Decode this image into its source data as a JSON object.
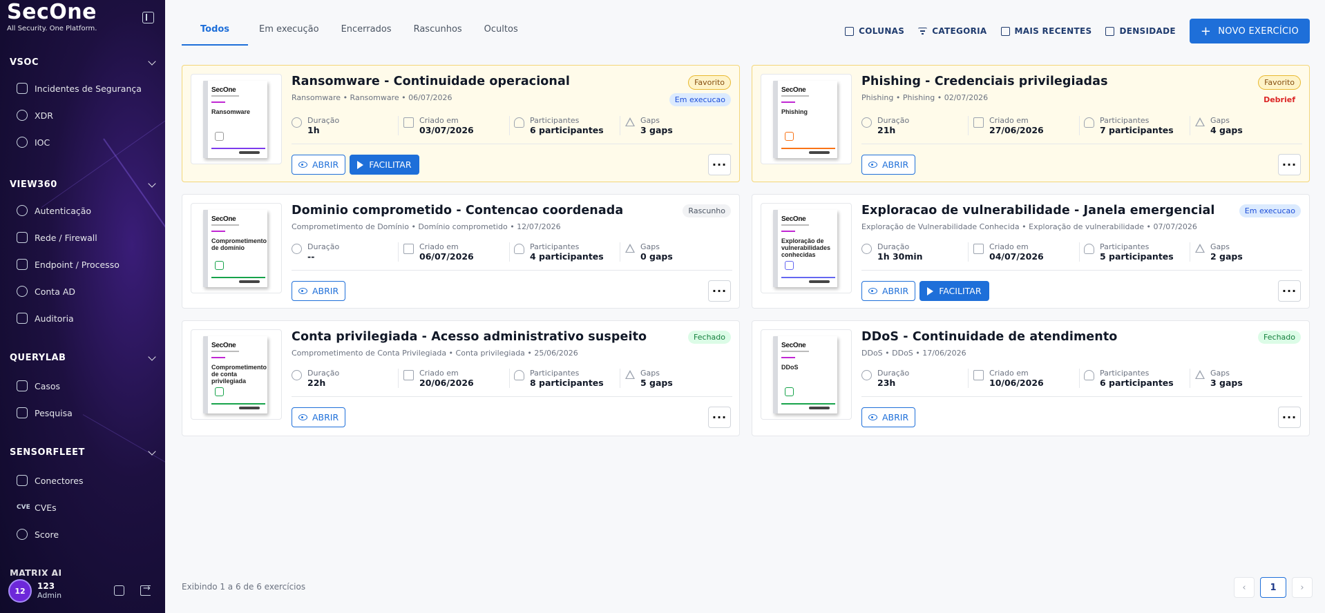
{
  "brand": {
    "name": "SecOne",
    "tagline": "All Security. One Platform."
  },
  "sidebar": {
    "sections": [
      {
        "title": "VSOC",
        "items": [
          {
            "label": "Incidentes de Segurança",
            "icon": "incident-icon"
          },
          {
            "label": "XDR",
            "icon": "radar-icon"
          },
          {
            "label": "IOC",
            "icon": "target-icon"
          }
        ]
      },
      {
        "title": "VIEW360",
        "items": [
          {
            "label": "Autenticação",
            "icon": "key-icon"
          },
          {
            "label": "Rede / Firewall",
            "icon": "network-icon"
          },
          {
            "label": "Endpoint / Processo",
            "icon": "cpu-icon"
          },
          {
            "label": "Conta AD",
            "icon": "user-icon"
          },
          {
            "label": "Auditoria",
            "icon": "audit-icon"
          }
        ]
      },
      {
        "title": "QUERYLAB",
        "items": [
          {
            "label": "Casos",
            "icon": "briefcase-icon"
          },
          {
            "label": "Pesquisa",
            "icon": "search-doc-icon"
          }
        ]
      },
      {
        "title": "SENSORFLEET",
        "items": [
          {
            "label": "Conectores",
            "icon": "connector-icon"
          },
          {
            "label": "CVEs",
            "icon": "cve-icon"
          },
          {
            "label": "Score",
            "icon": "gauge-icon"
          }
        ]
      }
    ],
    "partial_section": "MATRIX AI",
    "user": {
      "initials": "12",
      "name": "123",
      "role": "Admin"
    }
  },
  "tabs": [
    "Todos",
    "Em execução",
    "Encerrados",
    "Rascunhos",
    "Ocultos"
  ],
  "active_tab": "Todos",
  "toolbar": {
    "columns": "COLUNAS",
    "category": "CATEGORIA",
    "sort": "MAIS RECENTES",
    "density": "DENSIDADE",
    "new_button": "NOVO EXERCÍCIO"
  },
  "labels": {
    "duration": "Duração",
    "created": "Criado em",
    "participants": "Participantes",
    "gaps": "Gaps",
    "open": "ABRIR",
    "facilitate": "FACILITAR",
    "more": "···"
  },
  "cards": [
    {
      "title": "Ransomware - Continuidade operacional",
      "subtitle": "Ransomware • Ransomware • 06/07/2026",
      "cover_title": "Ransomware",
      "badges": [
        "Favorito",
        "Em execucao"
      ],
      "duration": "1h",
      "created": "03/07/2026",
      "participants": "6 participantes",
      "gaps": "3 gaps"
    },
    {
      "title": "Phishing - Credenciais privilegiadas",
      "subtitle": "Phishing • Phishing • 02/07/2026",
      "cover_title": "Phishing",
      "badges": [
        "Favorito",
        "Debrief"
      ],
      "duration": "21h",
      "created": "27/06/2026",
      "participants": "7 participantes",
      "gaps": "4 gaps"
    },
    {
      "title": "Dominio comprometido - Contencao coordenada",
      "subtitle": "Comprometimento de Domínio • Domínio comprometido • 12/07/2026",
      "cover_title": "Comprometimento de domínio",
      "badges": [
        "Rascunho"
      ],
      "duration": "--",
      "created": "06/07/2026",
      "participants": "4 participantes",
      "gaps": "0 gaps"
    },
    {
      "title": "Exploracao de vulnerabilidade - Janela emergencial",
      "subtitle": "Exploração de Vulnerabilidade Conhecida • Exploração de vulnerabilidade • 07/07/2026",
      "cover_title": "Exploração de vulnerabilidades conhecidas",
      "badges": [
        "Em execucao"
      ],
      "duration": "1h 30min",
      "created": "04/07/2026",
      "participants": "5 participantes",
      "gaps": "2 gaps"
    },
    {
      "title": "Conta privilegiada - Acesso administrativo suspeito",
      "subtitle": "Comprometimento de Conta Privilegiada • Conta privilegiada • 25/06/2026",
      "cover_title": "Comprometimento de conta privilegiada",
      "badges": [
        "Fechado"
      ],
      "duration": "22h",
      "created": "20/06/2026",
      "participants": "8 participantes",
      "gaps": "5 gaps"
    },
    {
      "title": "DDoS - Continuidade de atendimento",
      "subtitle": "DDoS • DDoS • 17/06/2026",
      "cover_title": "DDoS",
      "badges": [
        "Fechado"
      ],
      "duration": "23h",
      "created": "10/06/2026",
      "participants": "6 participantes",
      "gaps": "3 gaps"
    }
  ],
  "footer": {
    "summary": "Exibindo 1 a 6 de 6 exercícios",
    "page": "1",
    "prev": "‹",
    "next": "›"
  }
}
